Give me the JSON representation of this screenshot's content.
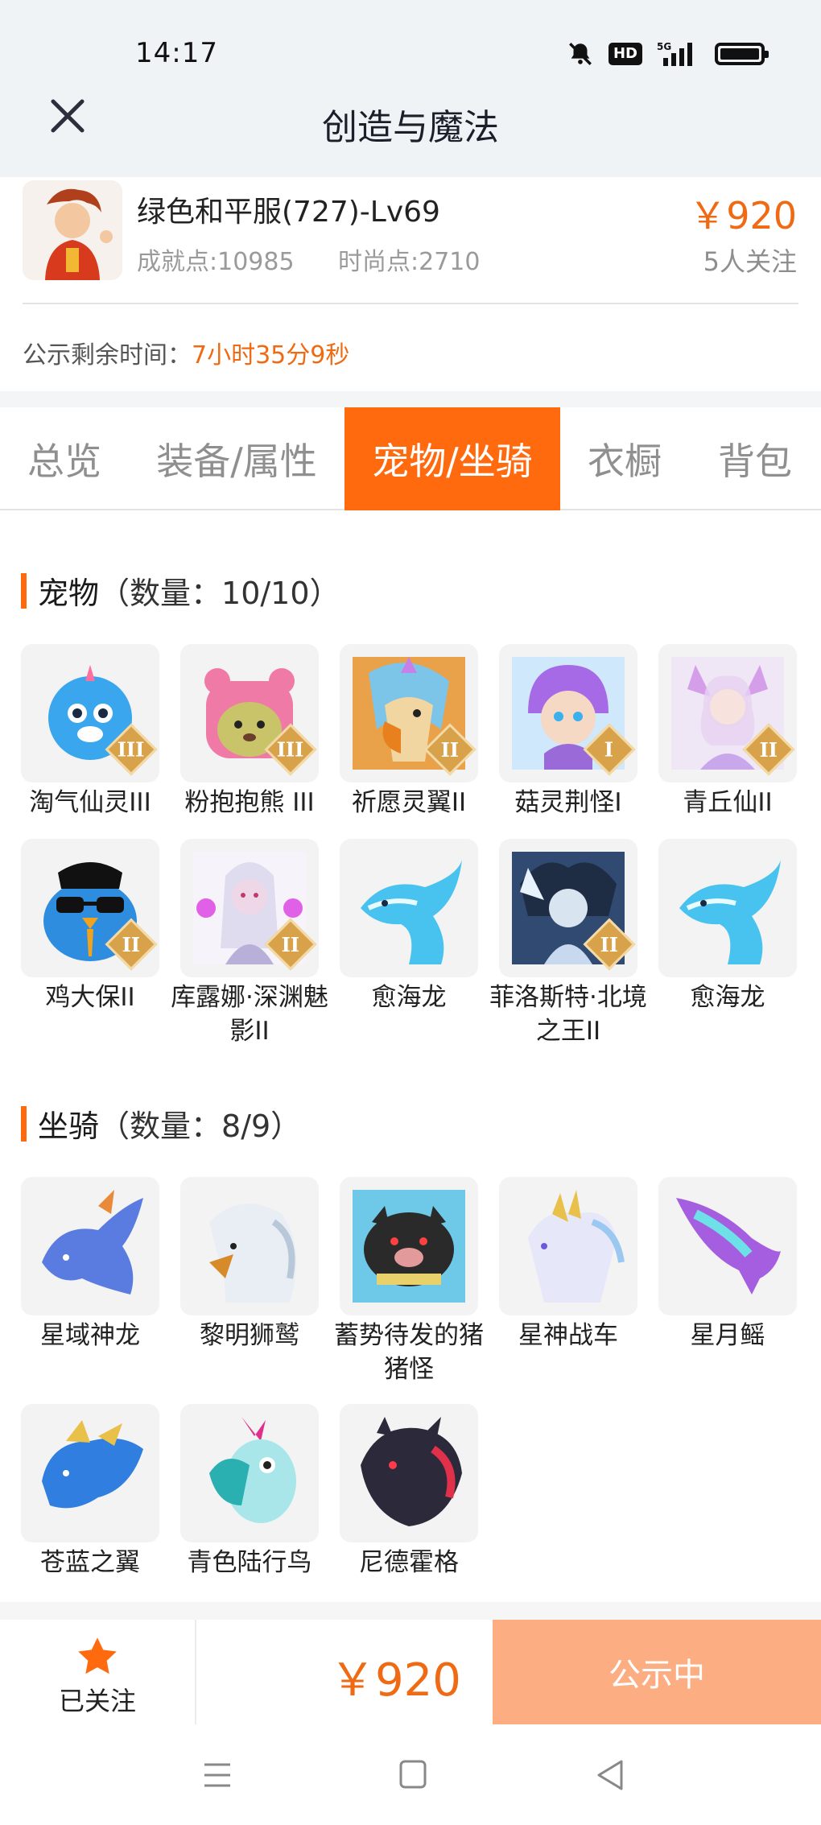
{
  "status_bar": {
    "time": "14:17",
    "hd": "HD",
    "network": "5G",
    "icons": [
      "bell-muted-icon",
      "hd-icon",
      "signal-5g-icon",
      "battery-icon"
    ]
  },
  "header": {
    "title": "创造与魔法",
    "close_icon": "close-icon"
  },
  "item": {
    "name": "绿色和平服(727)-Lv69",
    "achievement": "成就点:10985",
    "fashion": "时尚点:2710",
    "price": "￥920",
    "followers": "5人关注",
    "countdown_label": "公示剩余时间：",
    "countdown_value": "7小时35分9秒"
  },
  "tabs": [
    {
      "label": "总览",
      "active": false
    },
    {
      "label": "装备/属性",
      "active": false
    },
    {
      "label": "宠物/坐骑",
      "active": true
    },
    {
      "label": "衣橱",
      "active": false
    },
    {
      "label": "背包",
      "active": false
    }
  ],
  "pets": {
    "title": "宠物",
    "count": "（数量：10/10）",
    "items": [
      {
        "name": "淘气仙灵III",
        "grade": "III",
        "color": "#3aa6ee"
      },
      {
        "name": "粉抱抱熊 III",
        "grade": "III",
        "color": "#f07aa6"
      },
      {
        "name": "祈愿灵翼II",
        "grade": "II",
        "color": "#e48a3c"
      },
      {
        "name": "菇灵荆怪I",
        "grade": "I",
        "color": "#a77be6"
      },
      {
        "name": "青丘仙II",
        "grade": "II",
        "color": "#d4a4e8"
      },
      {
        "name": "鸡大保II",
        "grade": "II",
        "color": "#2f8de0"
      },
      {
        "name": "库露娜·深渊魅影II",
        "grade": "II",
        "color": "#c9b8e8"
      },
      {
        "name": "愈海龙",
        "grade": "",
        "color": "#48c3f0"
      },
      {
        "name": "菲洛斯特·北境之王II",
        "grade": "II",
        "color": "#4b6a9a"
      },
      {
        "name": "愈海龙",
        "grade": "",
        "color": "#48c3f0"
      }
    ]
  },
  "mounts": {
    "title": "坐骑",
    "count": "（数量：8/9）",
    "items": [
      {
        "name": "星域神龙",
        "color": "#5a7be0"
      },
      {
        "name": "黎明狮鹫",
        "color": "#b9c8d8"
      },
      {
        "name": "蓄势待发的猪猪怪",
        "color": "#2a2a2a"
      },
      {
        "name": "星神战车",
        "color": "#c8c4ee"
      },
      {
        "name": "星月鳐",
        "color": "#a55ee0"
      },
      {
        "name": "苍蓝之翼",
        "color": "#2f7ee0"
      },
      {
        "name": "青色陆行鸟",
        "color": "#4cc8c8"
      },
      {
        "name": "尼德霍格",
        "color": "#2c2a3a"
      }
    ]
  },
  "action_bar": {
    "follow_label": "已关注",
    "follow_icon": "star-icon",
    "price": "￥920",
    "status_button": "公示中",
    "accent": "#ef6a12"
  },
  "nav": {
    "icons": [
      "menu-icon",
      "home-icon",
      "back-icon"
    ]
  }
}
